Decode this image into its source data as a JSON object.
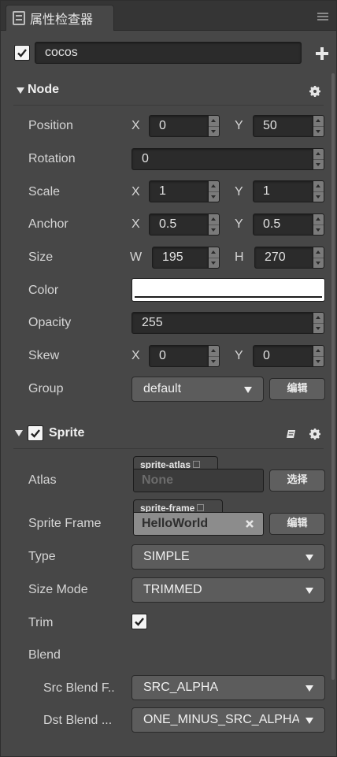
{
  "tab": {
    "title": "属性检查器",
    "icon": "inspector-icon"
  },
  "node_name": {
    "value": "cocos",
    "enabled": true
  },
  "node_section": {
    "title": "Node",
    "position": {
      "label": "Position",
      "x_axis": "X",
      "x": "0",
      "y_axis": "Y",
      "y": "50"
    },
    "rotation": {
      "label": "Rotation",
      "value": "0"
    },
    "scale": {
      "label": "Scale",
      "x_axis": "X",
      "x": "1",
      "y_axis": "Y",
      "y": "1"
    },
    "anchor": {
      "label": "Anchor",
      "x_axis": "X",
      "x": "0.5",
      "y_axis": "Y",
      "y": "0.5"
    },
    "size": {
      "label": "Size",
      "w_axis": "W",
      "w": "195",
      "h_axis": "H",
      "h": "270"
    },
    "color": {
      "label": "Color",
      "value": "#ffffff"
    },
    "opacity": {
      "label": "Opacity",
      "value": "255"
    },
    "skew": {
      "label": "Skew",
      "x_axis": "X",
      "x": "0",
      "y_axis": "Y",
      "y": "0"
    },
    "group": {
      "label": "Group",
      "value": "default",
      "button": "编辑"
    }
  },
  "sprite_section": {
    "title": "Sprite",
    "enabled": true,
    "atlas": {
      "label": "Atlas",
      "tag": "sprite-atlas",
      "value": "None",
      "button": "选择"
    },
    "sprite_frame": {
      "label": "Sprite Frame",
      "tag": "sprite-frame",
      "value": "HelloWorld",
      "button": "编辑"
    },
    "type": {
      "label": "Type",
      "value": "SIMPLE"
    },
    "size_mode": {
      "label": "Size Mode",
      "value": "TRIMMED"
    },
    "trim": {
      "label": "Trim",
      "checked": true
    },
    "blend": {
      "label": "Blend"
    },
    "src_blend": {
      "label": "Src Blend F..",
      "value": "SRC_ALPHA"
    },
    "dst_blend": {
      "label": "Dst Blend ...",
      "value": "ONE_MINUS_SRC_ALPHA"
    }
  }
}
